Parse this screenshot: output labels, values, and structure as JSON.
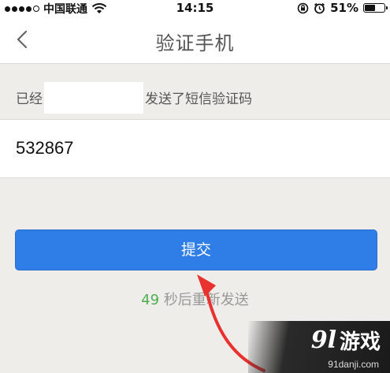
{
  "status_bar": {
    "carrier": "中国联通",
    "time": "14:15",
    "battery_text": "51%",
    "battery_level": 0.51,
    "signal_bars": 4,
    "icons": [
      "wifi-icon",
      "rotation-lock-icon",
      "alarm-icon",
      "battery-icon"
    ]
  },
  "nav": {
    "title": "验证手机",
    "back_icon": "chevron-left-icon"
  },
  "info": {
    "prefix": "已经",
    "suffix": "发送了短信验证码"
  },
  "code_field": {
    "value": "532867"
  },
  "submit": {
    "label": "提交",
    "color": "#2f7ee8"
  },
  "resend": {
    "seconds": "49",
    "text": "秒后重新发送",
    "seconds_color": "#4caf50"
  },
  "watermark": {
    "brand_number": "9l",
    "brand_text": "游戏",
    "url": "91danji.com"
  }
}
